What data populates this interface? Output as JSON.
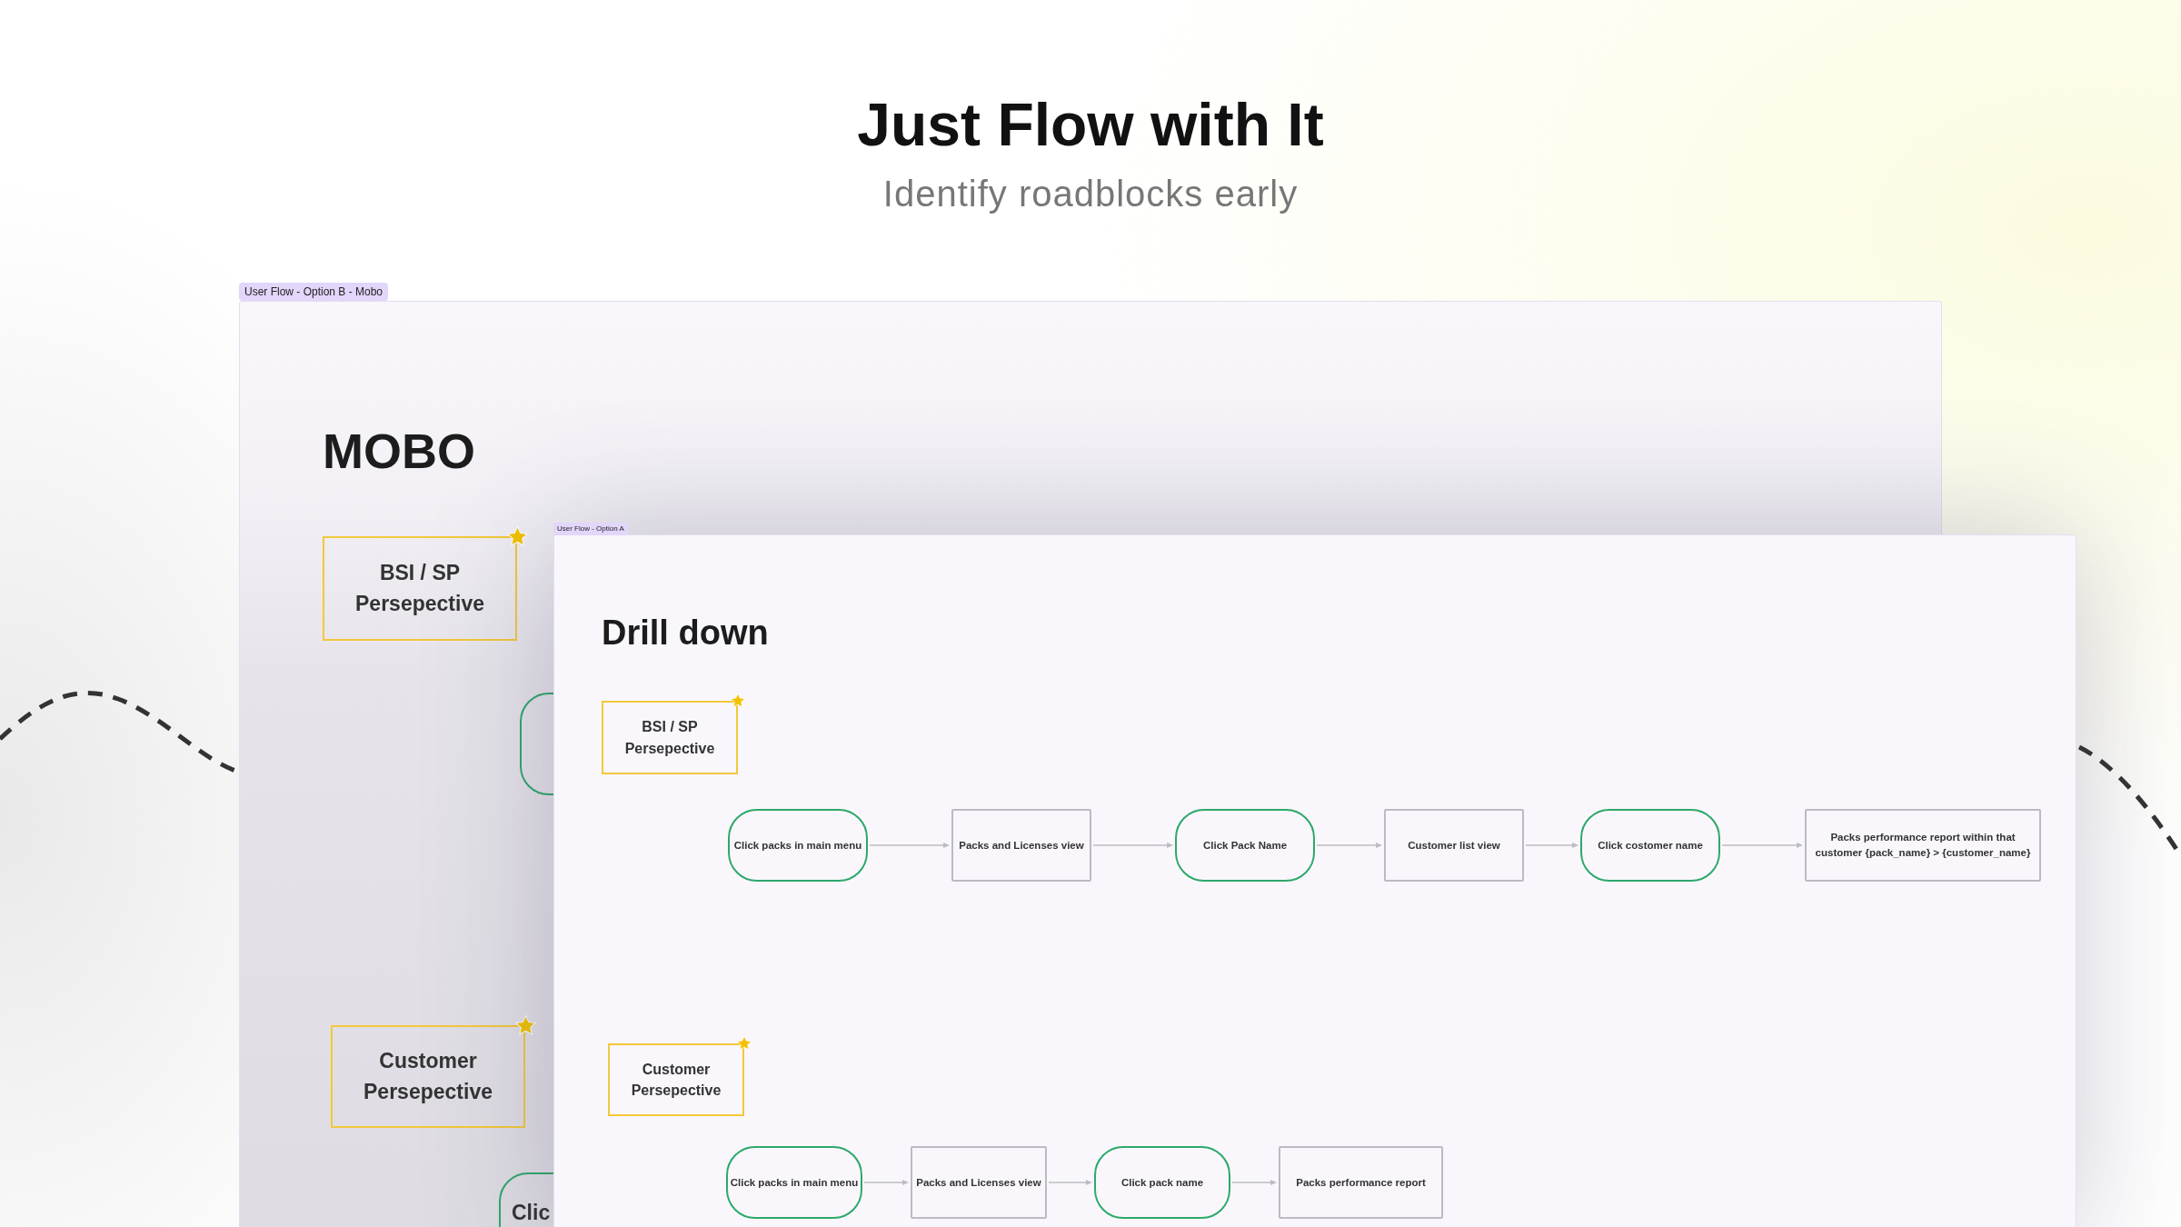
{
  "header": {
    "title": "Just Flow with It",
    "subtitle": "Identify roadblocks early"
  },
  "frames": [
    {
      "label": "User Flow - Option B - Mobo",
      "title": "MOBO",
      "flows": [
        {
          "perspective": {
            "label": "BSI / SP Persepective",
            "starred": true
          },
          "steps": [
            {
              "kind": "action"
            }
          ]
        },
        {
          "perspective": {
            "label": "Customer Persepective",
            "starred": true
          },
          "steps": [
            {
              "kind": "action",
              "text": "Clic"
            }
          ]
        }
      ]
    },
    {
      "label": "User Flow - Option A",
      "title": "Drill down",
      "flows": [
        {
          "perspective": {
            "label": "BSI / SP Persepective",
            "starred": true
          },
          "steps": [
            {
              "kind": "action",
              "text": "Click packs in main menu"
            },
            {
              "kind": "screen",
              "text": "Packs and Licenses view"
            },
            {
              "kind": "action",
              "text": "Click Pack Name"
            },
            {
              "kind": "screen",
              "text": "Customer list view"
            },
            {
              "kind": "action",
              "text": "Click costomer name"
            },
            {
              "kind": "screen",
              "text": "Packs performance report within that customer {pack_name} > {customer_name}"
            }
          ]
        },
        {
          "perspective": {
            "label": "Customer Persepective",
            "starred": true
          },
          "steps": [
            {
              "kind": "action",
              "text": "Click packs in main menu"
            },
            {
              "kind": "screen",
              "text": "Packs and Licenses view"
            },
            {
              "kind": "action",
              "text": "Click pack name"
            },
            {
              "kind": "screen",
              "text": "Packs performance report"
            }
          ]
        }
      ]
    }
  ]
}
